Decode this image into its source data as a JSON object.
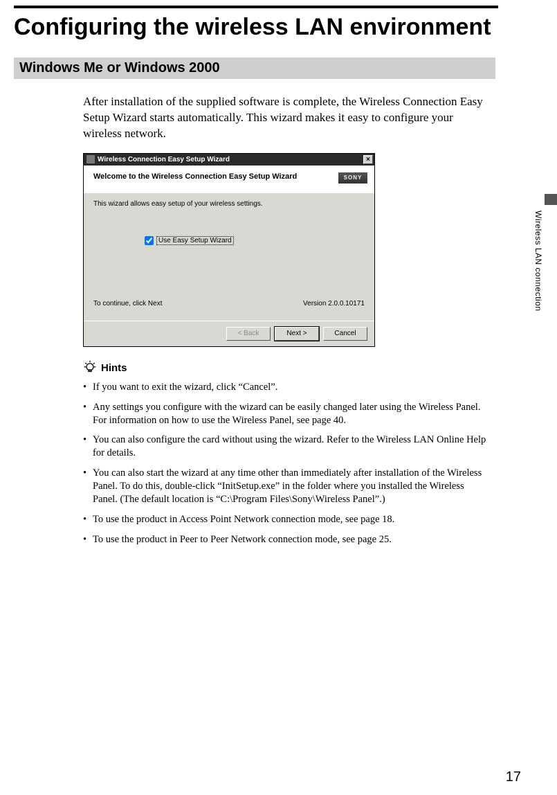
{
  "page": {
    "title": "Configuring the wireless LAN environment",
    "section": "Windows Me or Windows 2000",
    "intro": "After installation of the supplied software is complete, the Wireless Connection Easy Setup Wizard starts automatically. This wizard makes it easy to configure your wireless network.",
    "side_label": "Wireless LAN connection",
    "number": "17"
  },
  "wizard": {
    "window_title": "Wireless Connection Easy Setup Wizard",
    "close_glyph": "×",
    "headline": "Welcome to the Wireless Connection Easy Setup Wizard",
    "brand": "SONY",
    "description": "This wizard allows easy setup of your wireless settings.",
    "checkbox_label": "Use Easy Setup Wizard",
    "continue_text": "To continue, click Next",
    "version_text": "Version 2.0.0.10171",
    "btn_back": "< Back",
    "btn_next": "Next >",
    "btn_cancel": "Cancel"
  },
  "hints": {
    "heading": "Hints",
    "items": [
      "If you want to exit the wizard, click “Cancel”.",
      "Any settings you configure with the wizard can be easily changed later using the Wireless Panel. For information on how to use the Wireless Panel, see page 40.",
      "You can also configure the card without using the wizard. Refer to the Wireless LAN Online Help for details.",
      "You can also start the wizard at any time other than immediately after installation of the Wireless Panel. To do this, double-click “InitSetup.exe” in the folder where you installed the Wireless Panel. (The default location is “C:\\Program Files\\Sony\\Wireless Panel”.)",
      "To use the product in Access Point Network connection mode, see page 18.",
      "To use the product in Peer to Peer Network connection mode, see page 25."
    ]
  }
}
